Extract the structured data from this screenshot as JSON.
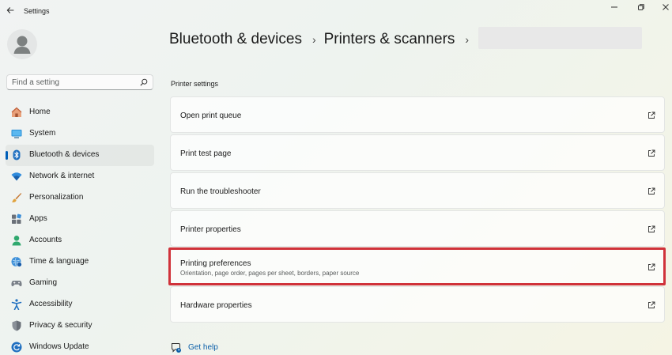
{
  "window": {
    "title": "Settings",
    "controls": [
      "minimize",
      "restore",
      "close"
    ]
  },
  "search": {
    "placeholder": "Find a setting"
  },
  "sidebar": {
    "items": [
      {
        "label": "Home",
        "icon": "home-icon"
      },
      {
        "label": "System",
        "icon": "system-icon"
      },
      {
        "label": "Bluetooth & devices",
        "icon": "bluetooth-icon",
        "active": true
      },
      {
        "label": "Network & internet",
        "icon": "wifi-icon"
      },
      {
        "label": "Personalization",
        "icon": "brush-icon"
      },
      {
        "label": "Apps",
        "icon": "apps-icon"
      },
      {
        "label": "Accounts",
        "icon": "accounts-icon"
      },
      {
        "label": "Time & language",
        "icon": "globe-clock-icon"
      },
      {
        "label": "Gaming",
        "icon": "gamepad-icon"
      },
      {
        "label": "Accessibility",
        "icon": "accessibility-icon"
      },
      {
        "label": "Privacy & security",
        "icon": "shield-icon"
      },
      {
        "label": "Windows Update",
        "icon": "update-icon"
      }
    ]
  },
  "breadcrumb": {
    "items": [
      "Bluetooth & devices",
      "Printers & scanners"
    ],
    "separator": "›"
  },
  "section": {
    "title": "Printer settings"
  },
  "cards": [
    {
      "title": "Open print queue",
      "icon": "open-external-icon"
    },
    {
      "title": "Print test page",
      "icon": "open-external-icon"
    },
    {
      "title": "Run the troubleshooter",
      "icon": "open-external-icon"
    },
    {
      "title": "Printer properties",
      "icon": "open-external-icon"
    },
    {
      "title": "Printing preferences",
      "subtitle": "Orientation, page order, pages per sheet, borders, paper source",
      "icon": "open-external-icon",
      "highlighted": true
    },
    {
      "title": "Hardware properties",
      "icon": "open-external-icon"
    }
  ],
  "help": {
    "label": "Get help"
  },
  "colors": {
    "accent": "#005fb8",
    "highlight": "#d0323a",
    "link": "#0a5ea8"
  }
}
